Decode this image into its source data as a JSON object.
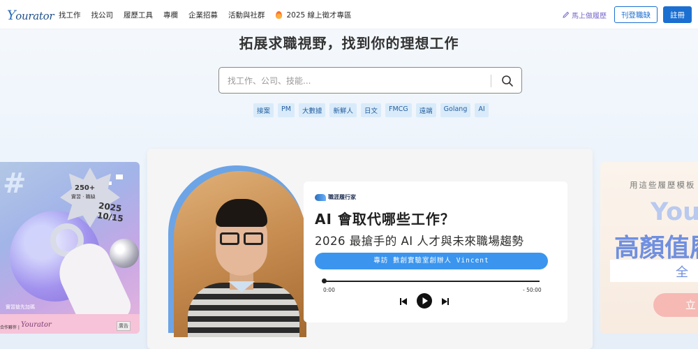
{
  "nav": {
    "logo": "ourator",
    "logo_initial": "Y",
    "links": [
      "找工作",
      "找公司",
      "履歷工具",
      "專欄",
      "企業招募",
      "活動與社群"
    ],
    "event_link": "2025 線上徵才專區",
    "resume_link": "馬上做履歷",
    "post_job": "刊登職缺",
    "register": "註冊"
  },
  "hero": {
    "title": "拓展求職視野，找到你的理想工作",
    "search_placeholder": "找工作、公司、技能...",
    "tags": [
      "接案",
      "PM",
      "大數據",
      "新鮮人",
      "日文",
      "FMCG",
      "遠端",
      "Golang",
      "AI"
    ]
  },
  "carousel": {
    "left": {
      "badge_line1": "250+",
      "badge_line2": "實習 · 職缺",
      "date_line1": "2025",
      "date_line2": "10/15",
      "caption": "實習搶先加碼",
      "partner": "合作夥伴 |",
      "brand": "Yourator",
      "ad": "廣告"
    },
    "main": {
      "brand": "職涯履行家",
      "title": "AI 會取代哪些工作？",
      "subtitle": "2026 最搶手的 AI 人才與未來職場趨勢",
      "pill": "專訪 數創實驗室創辦人 Vincent",
      "time_start": "0:00",
      "time_end": "- 50:00"
    },
    "right": {
      "line1": "用這些履歷模板",
      "line2": "Your",
      "line3": "高顏值履",
      "line4": "全 新",
      "button": "立"
    }
  },
  "colors": {
    "primary": "#1b6fd1",
    "tag_bg": "#d9ebfa",
    "accent_purple": "#7a68c9"
  }
}
